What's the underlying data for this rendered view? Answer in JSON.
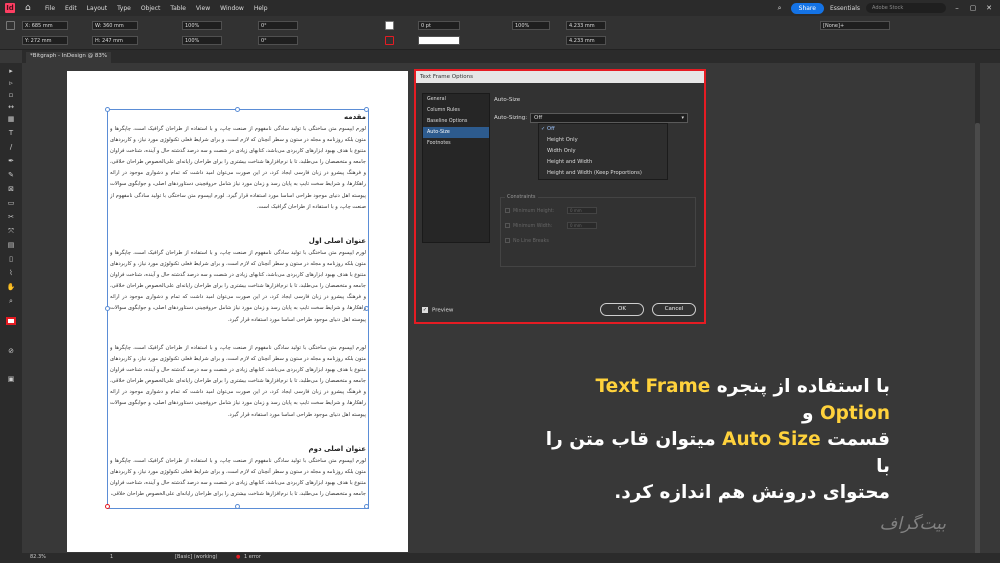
{
  "menubar": {
    "logo": "Id",
    "items": [
      "File",
      "Edit",
      "Layout",
      "Type",
      "Object",
      "Table",
      "View",
      "Window",
      "Help"
    ],
    "share": "Share",
    "workspace": "Essentials",
    "stock_placeholder": "Adobe Stock"
  },
  "control": {
    "x": "X: 685 mm",
    "y": "Y: 272 mm",
    "w": "W: 360 mm",
    "h": "H: 247 mm",
    "scale_x": "100%",
    "scale_y": "100%",
    "rotate": "0°",
    "shear": "0°",
    "stroke": "0 pt",
    "pct": "100%",
    "offset1": "4.233 mm",
    "offset2": "4.233 mm",
    "style": "[None]+"
  },
  "tab": {
    "title": "*Bitgraph - InDesign @ 83%"
  },
  "doc": {
    "heading1": "مقدمه",
    "para1": "لورم ایپسوم متن ساختگی با تولید سادگی نامفهوم از صنعت چاپ، و با استفاده از طراحان گرافیک است، چاپگرها و متون بلکه روزنامه و مجله در ستون و سطر آنچنان که لازم است، و برای شرایط فعلی تکنولوژی مورد نیاز، و کاربردهای متنوع با هدف بهبود ابزارهای کاربردی می‌باشد، کتابهای زیادی در شصت و سه درصد گذشته حال و آینده، شناخت فراوان جامعه و متخصصان را می‌طلبد، تا با نرم‌افزارها شناخت بیشتری را برای طراحان رایانه‌ای علی‌الخصوص طراحان خلاقی، و فرهنگ پیشرو در زبان فارسی ایجاد کرد، در این صورت می‌توان امید داشت که تمام و دشواری موجود در ارائه راهکارها، و شرایط سخت تایپ به پایان رسد و زمان مورد نیاز شامل حروفچینی دستاوردهای اصلی، و جوابگوی سوالات پیوسته اهل دنیای موجود طراحی اساسا مورد استفاده قرار گیرد. لورم ایپسوم متن ساختگی با تولید سادگی نامفهوم از صنعت چاپ، و با استفاده از طراحان گرافیک است.",
    "heading2": "عنوان اصلی اول",
    "para2": "لورم ایپسوم متن ساختگی با تولید سادگی نامفهوم از صنعت چاپ، و با استفاده از طراحان گرافیک است، چاپگرها و متون بلکه روزنامه و مجله در ستون و سطر آنچنان که لازم است، و برای شرایط فعلی تکنولوژی مورد نیاز، و کاربردهای متنوع با هدف بهبود ابزارهای کاربردی می‌باشد، کتابهای زیادی در شصت و سه درصد گذشته حال و آینده، شناخت فراوان جامعه و متخصصان را می‌طلبد، تا با نرم‌افزارها شناخت بیشتری را برای طراحان رایانه‌ای علی‌الخصوص طراحان خلاقی، و فرهنگ پیشرو در زبان فارسی ایجاد کرد، در این صورت می‌توان امید داشت که تمام و دشواری موجود در ارائه راهکارها، و شرایط سخت تایپ به پایان رسد و زمان مورد نیاز شامل حروفچینی دستاوردهای اصلی، و جوابگوی سوالات پیوسته اهل دنیای موجود طراحی اساسا مورد استفاده قرار گیرد.",
    "para3": "لورم ایپسوم متن ساختگی با تولید سادگی نامفهوم از صنعت چاپ، و با استفاده از طراحان گرافیک است، چاپگرها و متون بلکه روزنامه و مجله در ستون و سطر آنچنان که لازم است، و برای شرایط فعلی تکنولوژی مورد نیاز، و کاربردهای متنوع با هدف بهبود ابزارهای کاربردی می‌باشد، کتابهای زیادی در شصت و سه درصد گذشته حال و آینده، شناخت فراوان جامعه و متخصصان را می‌طلبد، تا با نرم‌افزارها شناخت بیشتری را برای طراحان رایانه‌ای علی‌الخصوص طراحان خلاقی، و فرهنگ پیشرو در زبان فارسی ایجاد کرد، در این صورت می‌توان امید داشت که تمام و دشواری موجود در ارائه راهکارها، و شرایط سخت تایپ به پایان رسد و زمان مورد نیاز شامل حروفچینی دستاوردهای اصلی، و جوابگوی سوالات پیوسته اهل دنیای موجود طراحی اساسا مورد استفاده قرار گیرد.",
    "heading3": "عنوان اصلی دوم",
    "para4": "لورم ایپسوم متن ساختگی با تولید سادگی نامفهوم از صنعت چاپ، و با استفاده از طراحان گرافیک است، چاپگرها و متون بلکه روزنامه و مجله در ستون و سطر آنچنان که لازم است، و برای شرایط فعلی تکنولوژی مورد نیاز، و کاربردهای متنوع با هدف بهبود ابزارهای کاربردی می‌باشد، کتابهای زیادی در شصت و سه درصد گذشته حال و آینده، شناخت فراوان جامعه و متخصصان را می‌طلبد، تا با نرم‌افزارها شناخت بیشتری را برای طراحان رایانه‌ای علی‌الخصوص طراحان خلاقی،"
  },
  "dialog": {
    "title": "Text Frame Options",
    "sidebar": [
      "General",
      "Column Rules",
      "Baseline Options",
      "Auto-Size",
      "Footnotes"
    ],
    "section": "Auto-Size",
    "autosizing_label": "Auto-Sizing:",
    "autosizing_value": "Off",
    "options": [
      "Off",
      "Height Only",
      "Width Only",
      "Height and Width",
      "Height and Width (Keep Proportions)"
    ],
    "constraints_title": "Constraints",
    "min_height": "Minimum Height:",
    "min_height_val": "0 mm",
    "min_width": "Minimum Width:",
    "min_width_val": "0 mm",
    "no_line_breaks": "No Line Breaks",
    "preview": "Preview",
    "ok": "OK",
    "cancel": "Cancel"
  },
  "caption": {
    "line1a": "با استفاده از پنجره ",
    "line1b": "Text Frame Option",
    "line1c": " و",
    "line2a": "قسمت ",
    "line2b": "Auto Size",
    "line2c": " میتوان قاب متن را با",
    "line3": "محتوای درونش هم اندازه کرد."
  },
  "status": {
    "zoom": "82.3%",
    "page": "1",
    "style": "[Basic] (working)",
    "errors": "1 error"
  },
  "brand": "بیت‌گراف",
  "colors": {
    "dialog_border": "#e51c23",
    "highlight": "#ffd23c",
    "selection": "#5b8dd6",
    "share": "#1473e6"
  }
}
